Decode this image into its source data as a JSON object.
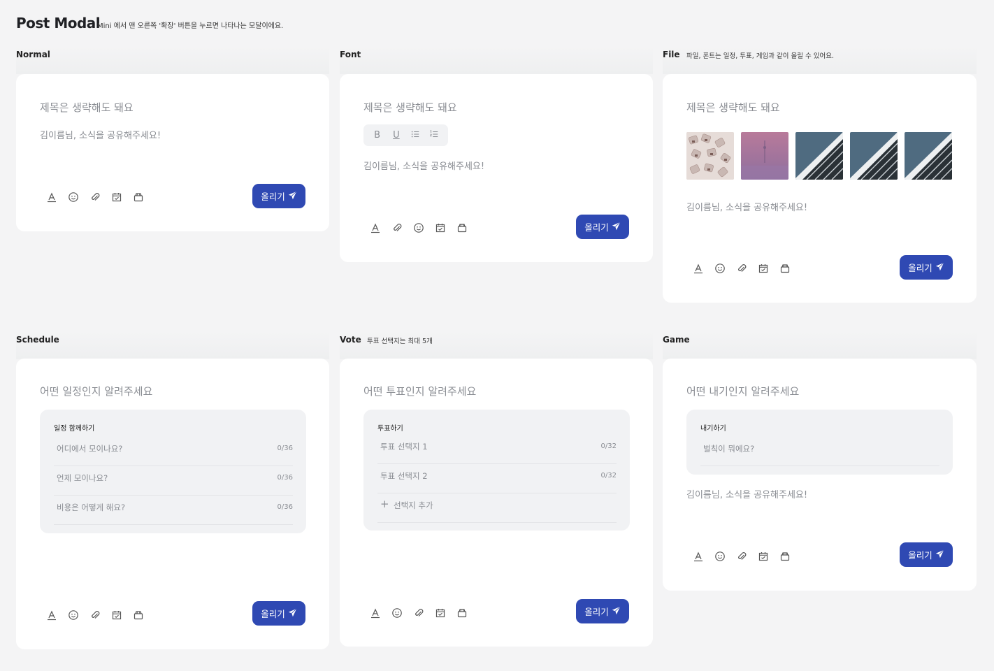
{
  "page": {
    "title": "Post Modal",
    "subtitle": "Mini 에서 맨 오른쪽 '확장' 버튼을 누르면 나타나는 모달이에요."
  },
  "common": {
    "title_placeholder": "제목은 생략해도 돼요",
    "body_placeholder": "김이름님, 소식을 공유해주세요!",
    "post_label": "올리기"
  },
  "sections": {
    "normal": {
      "label": "Normal"
    },
    "font": {
      "label": "Font",
      "format_buttons": [
        "B",
        "U"
      ]
    },
    "file": {
      "label": "File",
      "note": "파일, 폰트는 일정, 투표, 게임과 같이 올릴 수 있어요."
    },
    "schedule": {
      "label": "Schedule",
      "title_placeholder": "어떤 일정인지 알려주세요",
      "panel_title": "일정 함께하기",
      "rows": [
        {
          "label": "어디에서 모이나요?",
          "count": "0/36"
        },
        {
          "label": "언제 모이나요?",
          "count": "0/36"
        },
        {
          "label": "비용은 어떻게 해요?",
          "count": "0/36"
        }
      ]
    },
    "vote": {
      "label": "Vote",
      "note": "투표 선택지는 최대 5개",
      "title_placeholder": "어떤 투표인지 알려주세요",
      "panel_title": "투표하기",
      "rows": [
        {
          "label": "투표 선택지 1",
          "count": "0/32"
        },
        {
          "label": "투표 선택지 2",
          "count": "0/32"
        }
      ],
      "add_option": "선택지 추가",
      "add_symbol": "+"
    },
    "game": {
      "label": "Game",
      "title_placeholder": "어떤 내기인지 알려주세요",
      "panel_title": "내기하기",
      "rule_placeholder": "벌칙이 뭐에요?"
    }
  },
  "toolbar_icons": [
    "font-icon",
    "emoji-icon",
    "paperclip-icon",
    "calendar-check-icon",
    "game-box-icon"
  ],
  "file_thumbnails": [
    "keyboard-keys-photo",
    "pink-haze-photo",
    "building-facade-photo",
    "building-facade-photo",
    "building-facade-photo"
  ],
  "colors": {
    "accent": "#2f49b3",
    "placeholder": "#8a8d93",
    "background": "#f4f4f5",
    "panel": "#f1f2f4"
  }
}
